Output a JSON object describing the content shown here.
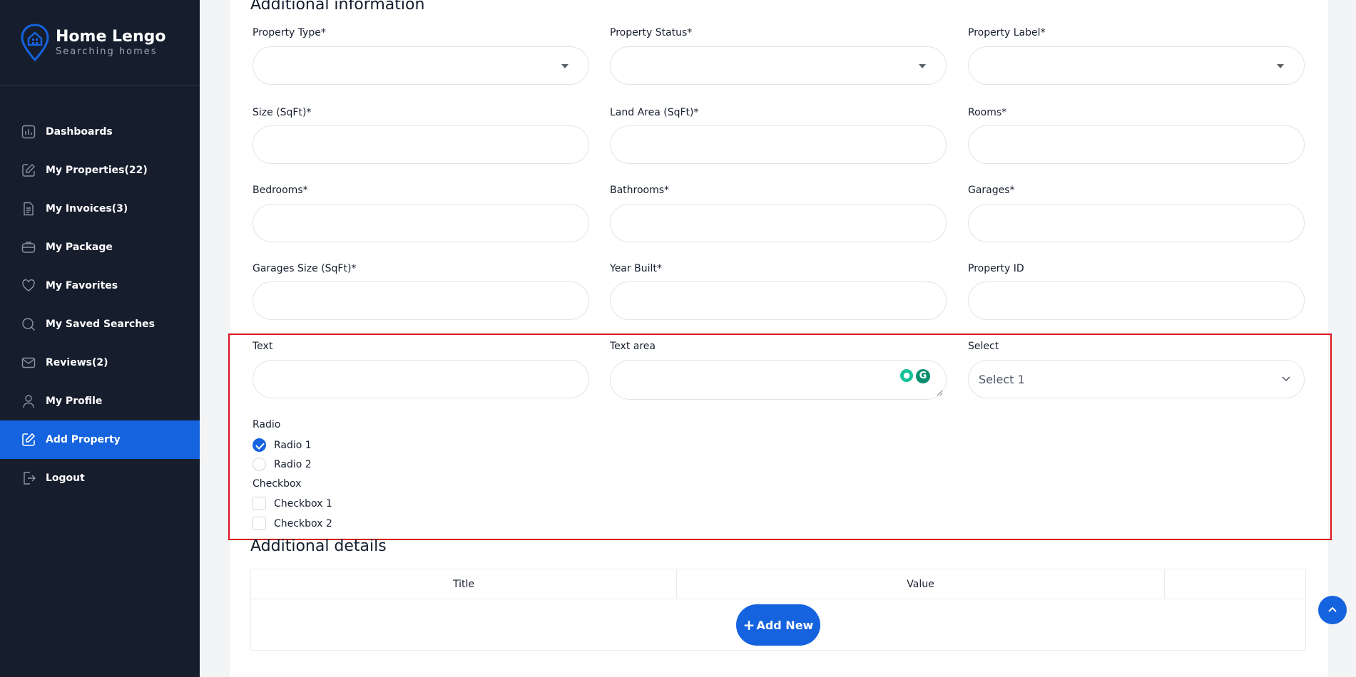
{
  "brand": {
    "name": "Home Lengo",
    "tagline": "Searching homes"
  },
  "sidebar": {
    "items": [
      {
        "label": "Dashboards",
        "icon": "chart-icon"
      },
      {
        "label": "My Properties(22)",
        "icon": "edit-icon"
      },
      {
        "label": "My Invoices(3)",
        "icon": "file-icon"
      },
      {
        "label": "My Package",
        "icon": "package-icon"
      },
      {
        "label": "My Favorites",
        "icon": "heart-icon"
      },
      {
        "label": "My Saved Searches",
        "icon": "search-icon"
      },
      {
        "label": "Reviews(2)",
        "icon": "mail-icon"
      },
      {
        "label": "My Profile",
        "icon": "user-icon"
      },
      {
        "label": "Add Property",
        "icon": "edit-icon",
        "active": true
      },
      {
        "label": "Logout",
        "icon": "logout-icon"
      }
    ]
  },
  "main": {
    "section_title": "Additional information",
    "fields": {
      "property_type": "Property Type*",
      "property_status": "Property Status*",
      "property_label": "Property Label*",
      "size": "Size (SqFt)*",
      "land_area": "Land Area (SqFt)*",
      "rooms": "Rooms*",
      "bedrooms": "Bedrooms*",
      "bathrooms": "Bathrooms*",
      "garages": "Garages*",
      "garages_size": "Garages Size (SqFt)*",
      "year_built": "Year Built*",
      "property_id": "Property ID"
    },
    "custom": {
      "text_label": "Text",
      "textarea_label": "Text area",
      "select_label": "Select",
      "select_value": "Select 1",
      "radio_label": "Radio",
      "radio_options": [
        "Radio 1",
        "Radio 2"
      ],
      "radio_selected": "Radio 1",
      "checkbox_label": "Checkbox",
      "checkbox_options": [
        "Checkbox 1",
        "Checkbox 2"
      ]
    },
    "details": {
      "title": "Additional details",
      "columns": [
        "Title",
        "Value"
      ],
      "add_button": "Add New"
    }
  },
  "colors": {
    "sidebar_bg": "#161e2d",
    "accent": "#1563df",
    "highlight_frame": "#d9141b"
  }
}
